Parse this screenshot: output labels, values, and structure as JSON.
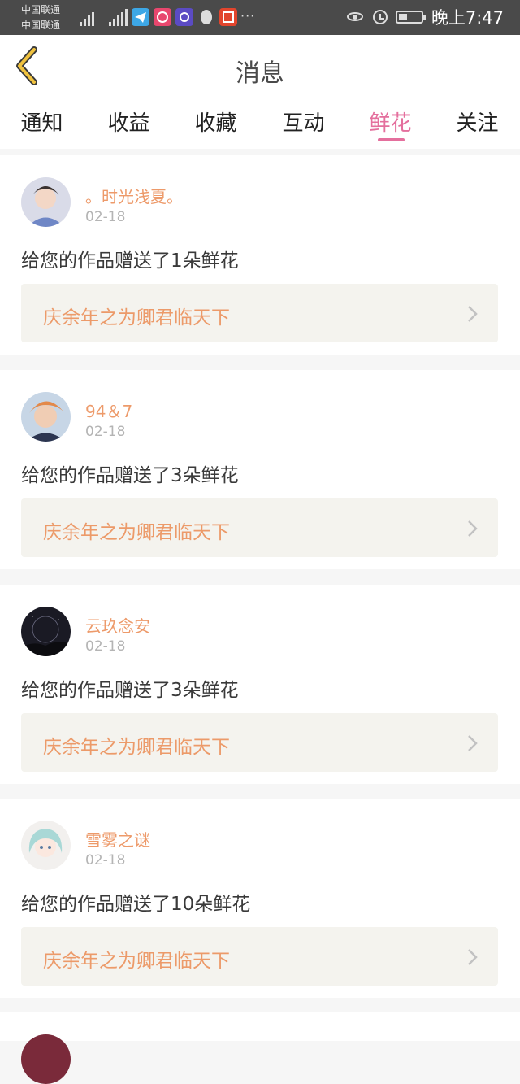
{
  "status_bar": {
    "carrier_1": "中国联通",
    "carrier_2": "中国联通",
    "network_1": "3G",
    "network_2": "4G",
    "app_icons": [
      "telegram-icon",
      "music-icon",
      "browser-icon",
      "qq-icon",
      "listen-app-icon"
    ],
    "more": "···",
    "time": "晚上7:47"
  },
  "header": {
    "back_icon": "chevron-left-icon",
    "title": "消息",
    "accent": "#e46f9d",
    "back_color": "#e0b43c"
  },
  "tabs": [
    {
      "label": "通知",
      "active": false
    },
    {
      "label": "收益",
      "active": false
    },
    {
      "label": "收藏",
      "active": false
    },
    {
      "label": "互动",
      "active": false
    },
    {
      "label": "鲜花",
      "active": true
    },
    {
      "label": "关注",
      "active": false
    }
  ],
  "notifications": [
    {
      "username": "。时光浅夏。",
      "date": "02-18",
      "message": "给您的作品赠送了1朵鲜花",
      "work": "庆余年之为卿君临天下"
    },
    {
      "username": "94＆7",
      "date": "02-18",
      "message": "给您的作品赠送了3朵鲜花",
      "work": "庆余年之为卿君临天下"
    },
    {
      "username": "云玖念安",
      "date": "02-18",
      "message": "给您的作品赠送了3朵鲜花",
      "work": "庆余年之为卿君临天下"
    },
    {
      "username": "雪雾之谜",
      "date": "02-18",
      "message": "给您的作品赠送了10朵鲜花",
      "work": "庆余年之为卿君临天下"
    }
  ]
}
